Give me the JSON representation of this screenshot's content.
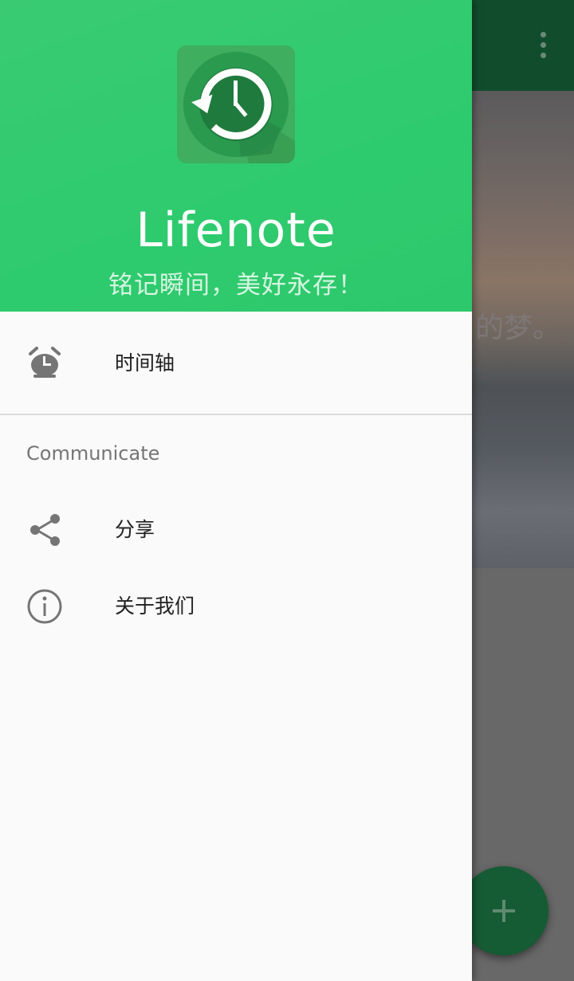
{
  "background": {
    "hero_text": "的梦。",
    "fab_icon": "plus-icon",
    "overflow_icon": "more-vertical-icon"
  },
  "drawer": {
    "header": {
      "logo_icon": "clock-history-icon",
      "app_name": "Lifenote",
      "tagline": "铭记瞬间，美好永存！"
    },
    "items": [
      {
        "icon": "alarm-clock-icon",
        "label": "时间轴"
      }
    ],
    "section": {
      "title": "Communicate",
      "items": [
        {
          "icon": "share-icon",
          "label": "分享"
        },
        {
          "icon": "info-icon",
          "label": "关于我们"
        }
      ]
    }
  },
  "colors": {
    "header_green": "#2ecb6e",
    "toolbar_green": "#114d2c",
    "icon_grey": "#757575",
    "drawer_bg": "#fafafa"
  }
}
